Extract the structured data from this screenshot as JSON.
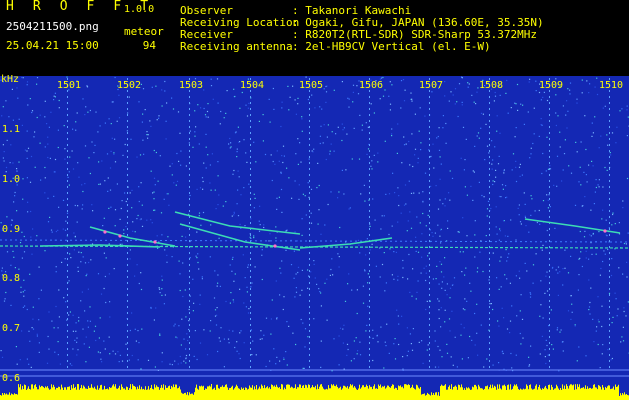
{
  "header": {
    "app_title": "H R O F F T",
    "version": "1.0.0",
    "filename": "2504211500.png",
    "datetime": "25.04.21 15:00",
    "meteor_label": "meteor",
    "meteor_count": "94",
    "info": [
      {
        "label": "Observer",
        "value": ": Takanori Kawachi"
      },
      {
        "label": "Receiving Location",
        "value": ": Ogaki, Gifu, JAPAN (136.60E, 35.35N)"
      },
      {
        "label": "Receiver",
        "value": ": R820T2(RTL-SDR) SDR-Sharp 53.372MHz"
      },
      {
        "label": "Receiving antenna",
        "value": ": 2el-HB9CV Vertical (el. E-W)"
      }
    ]
  },
  "spectrogram": {
    "y_unit": "kHz",
    "y_ticks": [
      "1.1",
      "1.0",
      "0.9",
      "0.8",
      "0.7",
      "0.6"
    ],
    "x_ticks": [
      "1501",
      "1502",
      "1503",
      "1504",
      "1505",
      "1506",
      "1507",
      "1508",
      "1509",
      "1510"
    ],
    "colors": {
      "background": "#1428b4",
      "noise": "#3c78ff",
      "signal": "#3cdcb4",
      "signal_hot": "#ff6ec8",
      "level_bar": "#ffff00",
      "text": "#ffff00"
    }
  }
}
